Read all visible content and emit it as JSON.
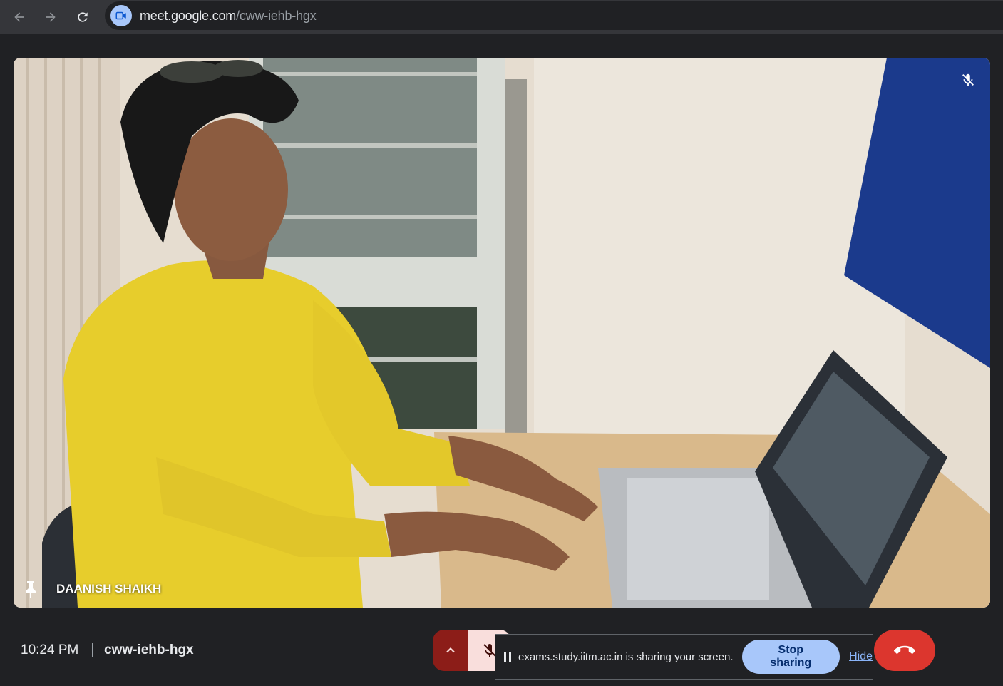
{
  "browser": {
    "url_host": "meet.google.com",
    "url_path": "/cww-iehb-hgx",
    "site_icon": "meet-camera-icon",
    "buttons": {
      "back": "back-arrow-icon",
      "forward": "forward-arrow-icon",
      "reload": "reload-icon"
    }
  },
  "tile": {
    "participant_name": "DAANISH SHAIKH",
    "mic_state_icon": "mic-off-icon",
    "pin_icon": "pin-icon"
  },
  "footer": {
    "time": "10:24 PM",
    "meeting_code": "cww-iehb-hgx"
  },
  "share_banner": {
    "message": "exams.study.iitm.ac.in is sharing your screen.",
    "stop_label": "Stop sharing",
    "hide_label": "Hide"
  },
  "colors": {
    "background": "#202124",
    "mic_off_bg": "#f9dedc",
    "mic_more_bg": "#8c1d18",
    "end_call": "#dc362e",
    "stop_sharing_bg": "#a8c7fa",
    "link": "#8ab4f8"
  }
}
